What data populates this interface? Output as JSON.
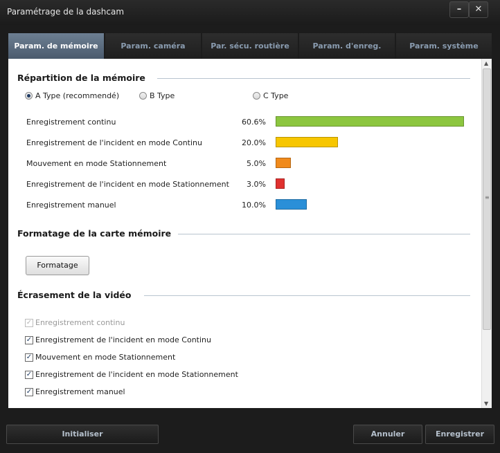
{
  "window": {
    "title": "Paramétrage de la dashcam",
    "minimize_glyph": "–",
    "close_glyph": "✕"
  },
  "tabs": [
    {
      "label": "Param. de mémoire",
      "active": true
    },
    {
      "label": "Param. caméra",
      "active": false
    },
    {
      "label": "Par. sécu. routière",
      "active": false
    },
    {
      "label": "Param. d'enreg.",
      "active": false
    },
    {
      "label": "Param. système",
      "active": false
    }
  ],
  "memory": {
    "section_title": "Répartition de la mémoire",
    "types": [
      {
        "label": "A Type (recommendé)",
        "checked": true
      },
      {
        "label": "B Type",
        "checked": false
      },
      {
        "label": "C Type",
        "checked": false
      }
    ],
    "rows": [
      {
        "label": "Enregistrement continu",
        "percent_text": "60.6%",
        "value": 60.6,
        "color": "#8cc63f"
      },
      {
        "label": "Enregistrement de l'incident en mode Continu",
        "percent_text": "20.0%",
        "value": 20.0,
        "color": "#f7c600"
      },
      {
        "label": "Mouvement en mode Stationnement",
        "percent_text": "5.0%",
        "value": 5.0,
        "color": "#f08a1c"
      },
      {
        "label": "Enregistrement de l'incident en mode Stationnement",
        "percent_text": "3.0%",
        "value": 3.0,
        "color": "#e0312f"
      },
      {
        "label": "Enregistrement manuel",
        "percent_text": "10.0%",
        "value": 10.0,
        "color": "#2a8fd8"
      }
    ]
  },
  "format": {
    "section_title": "Formatage de la carte mémoire",
    "button_label": "Formatage"
  },
  "overwrite": {
    "section_title": "Écrasement de la vidéo",
    "items": [
      {
        "label": "Enregistrement continu",
        "checked": true,
        "disabled": true
      },
      {
        "label": "Enregistrement de l'incident en mode Continu",
        "checked": true,
        "disabled": false
      },
      {
        "label": "Mouvement en mode Stationnement",
        "checked": true,
        "disabled": false
      },
      {
        "label": "Enregistrement de l'incident en mode Stationnement",
        "checked": true,
        "disabled": false
      },
      {
        "label": "Enregistrement manuel",
        "checked": true,
        "disabled": false
      }
    ]
  },
  "footer": {
    "reset_label": "Initialiser",
    "cancel_label": "Annuler",
    "save_label": "Enregistrer"
  }
}
